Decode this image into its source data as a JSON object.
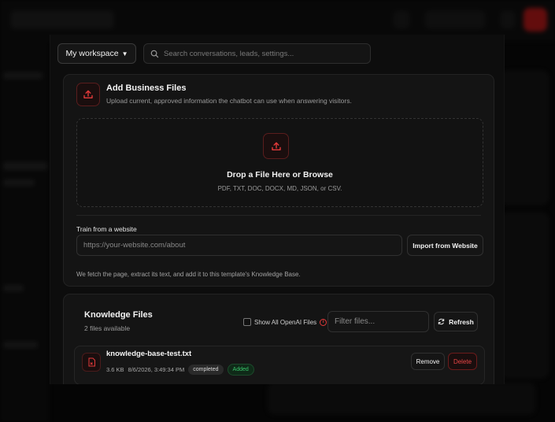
{
  "header": {
    "workspace_label": "My workspace",
    "search_placeholder": "Search conversations, leads, settings..."
  },
  "upload_card": {
    "title": "Add Business Files",
    "subtitle": "Upload current, approved information the chatbot can use when answering visitors.",
    "dropzone_title": "Drop a File Here or Browse",
    "dropzone_formats": "PDF, TXT, DOC, DOCX, MD, JSON, or CSV.",
    "website_label": "Train from a website",
    "website_placeholder": "https://your-website.com/about",
    "import_button": "Import from Website",
    "note": "We fetch the page, extract its text, and add it to this template's Knowledge Base."
  },
  "knowledge_card": {
    "title": "Knowledge Files",
    "count_text": "2 files available",
    "show_all_label": "Show All OpenAI Files",
    "filter_placeholder": "Filter files...",
    "refresh_button": "Refresh",
    "files": [
      {
        "name": "knowledge-base-test.txt",
        "size": "3.6 KB",
        "date": "8/6/2026, 3:49:34 PM",
        "status": "completed",
        "state": "Added",
        "remove_label": "Remove",
        "delete_label": "Delete"
      }
    ]
  },
  "colors": {
    "accent": "#e23a3a",
    "success": "#39c46a",
    "background": "#0d0d0d"
  }
}
